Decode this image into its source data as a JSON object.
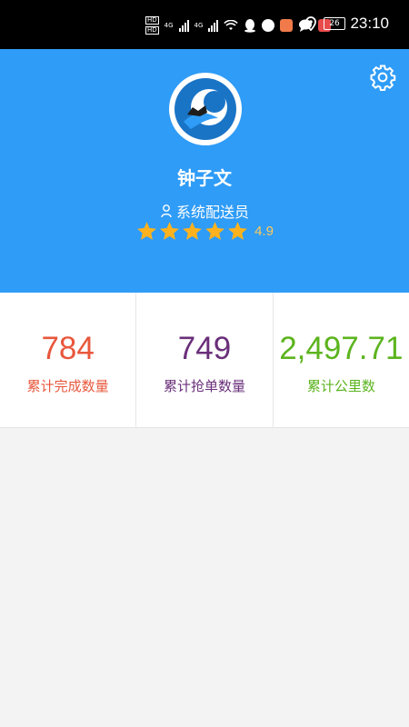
{
  "status_bar": {
    "time": "23:10",
    "network_tag_1": "HD",
    "network_tag_2": "HD",
    "network_4g_1": "4G",
    "network_4g_2": "4G",
    "battery": "26",
    "icons": [
      "signal-icon",
      "wifi-icon",
      "qq-icon",
      "camera-icon",
      "chat-icon",
      "message-icon",
      "app-red-icon",
      "location-icon",
      "battery-icon"
    ]
  },
  "profile": {
    "name": "钟子文",
    "role": "系统配送员",
    "rating_value": 4.9,
    "rating_text": "4.9",
    "stars": 5
  },
  "stats": [
    {
      "value": "784",
      "label": "累计完成数量",
      "color": "#e8573c"
    },
    {
      "value": "749",
      "label": "累计抢单数量",
      "color": "#6a2f7a"
    },
    {
      "value": "2,497.71",
      "label": "累计公里数",
      "color": "#5cb41e"
    }
  ],
  "colors": {
    "header_bg": "#2f9cf7",
    "star": "#ffb21e",
    "page_bg": "#f3f3f3"
  }
}
